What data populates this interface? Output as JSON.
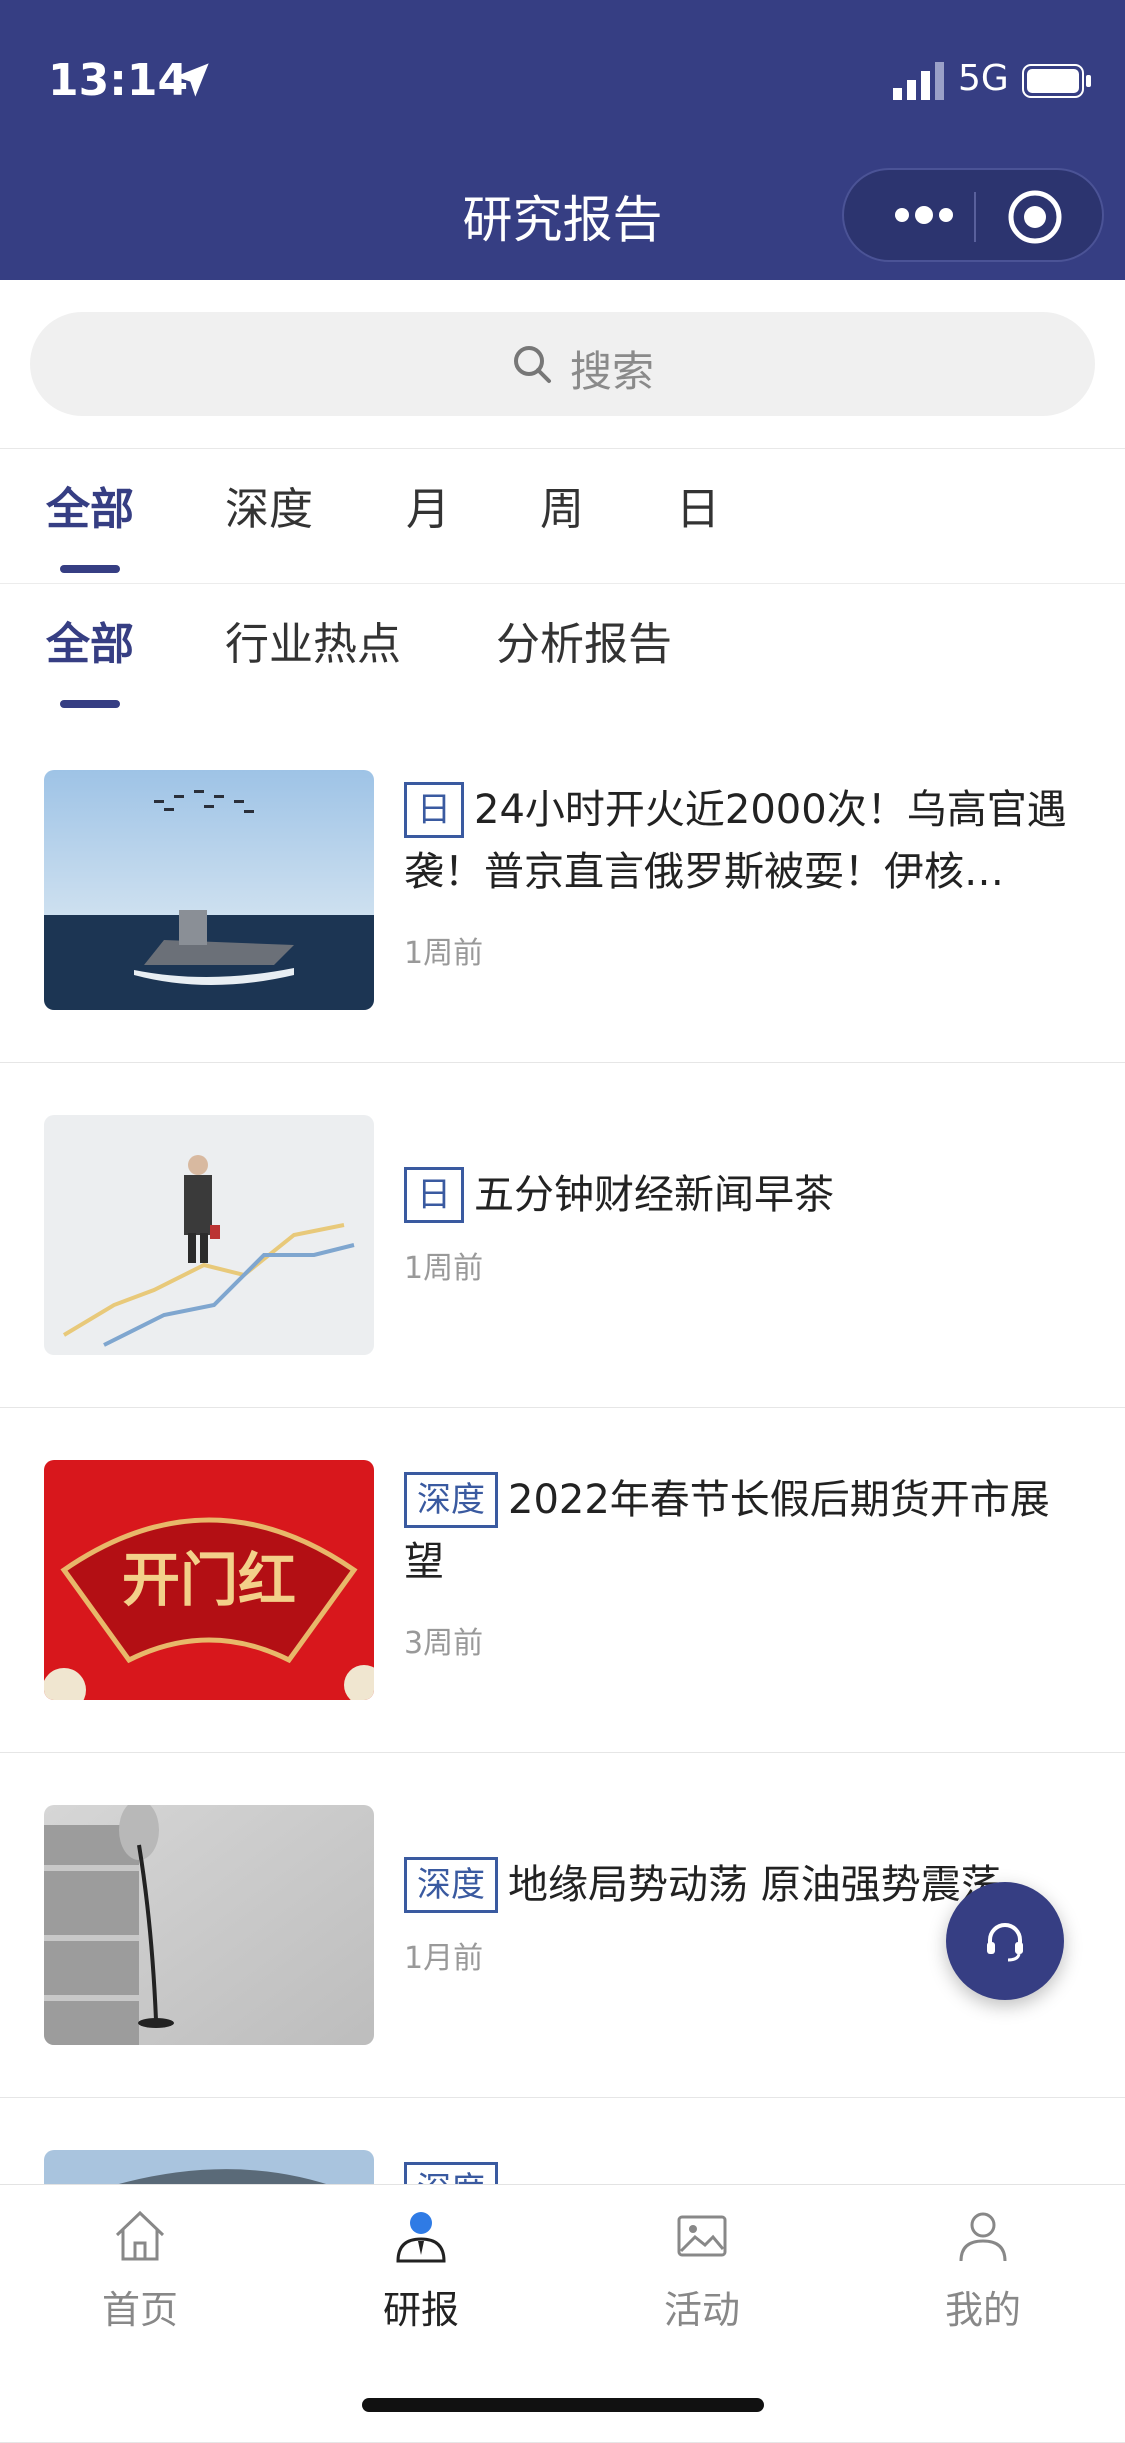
{
  "status": {
    "time": "13:14",
    "network": "5G"
  },
  "header": {
    "title": "研究报告"
  },
  "search": {
    "placeholder": "搜索"
  },
  "category_tabs": [
    "全部",
    "深度",
    "月",
    "周",
    "日"
  ],
  "type_tabs": [
    "全部",
    "行业热点",
    "分析报告"
  ],
  "items": [
    {
      "tag": "日",
      "title": "24小时开火近2000次！乌高官遇袭！普京直言俄罗斯被耍！伊核…",
      "time": "1周前",
      "thumb": "aircraft-carrier"
    },
    {
      "tag": "日",
      "title": "五分钟财经新闻早茶",
      "time": "1周前",
      "thumb": "businessman-chart"
    },
    {
      "tag": "深度",
      "title": "2022年春节长假后期货开市展望",
      "time": "3周前",
      "thumb": "red-opening"
    },
    {
      "tag": "深度",
      "title": "地缘局势动荡 原油强势震荡",
      "time": "1月前",
      "thumb": "oil-barrels"
    },
    {
      "tag": "深度",
      "title": "",
      "time": "",
      "thumb": "building"
    }
  ],
  "thumb_text": {
    "red_opening": "开门红"
  },
  "tabbar": [
    "首页",
    "研报",
    "活动",
    "我的"
  ],
  "colors": {
    "primary": "#363e83",
    "tag": "#3a5aa0"
  }
}
